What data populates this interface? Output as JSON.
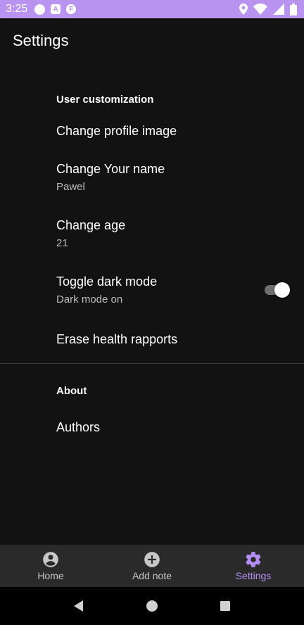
{
  "status_bar": {
    "time": "3:25",
    "icons": [
      "circle-icon",
      "a-icon",
      "f-icon",
      "location-icon",
      "wifi-icon",
      "signal-icon",
      "battery-icon"
    ]
  },
  "app_bar": {
    "title": "Settings"
  },
  "sections": {
    "user": {
      "header": "User customization",
      "profile_image": {
        "title": "Change profile image"
      },
      "name": {
        "title": "Change Your name",
        "summary": "Pawel"
      },
      "age": {
        "title": "Change age",
        "summary": "21"
      },
      "dark_mode": {
        "title": "Toggle dark mode",
        "summary": "Dark mode on",
        "enabled": true
      },
      "erase": {
        "title": "Erase health rapports"
      }
    },
    "about": {
      "header": "About",
      "authors": {
        "title": "Authors"
      }
    }
  },
  "bottom_nav": {
    "home": "Home",
    "add_note": "Add note",
    "settings": "Settings",
    "active": "settings"
  },
  "colors": {
    "status_bar": "#b894f0",
    "background": "#121212",
    "accent": "#b48ef2",
    "nav_background": "#2a2a2a"
  }
}
